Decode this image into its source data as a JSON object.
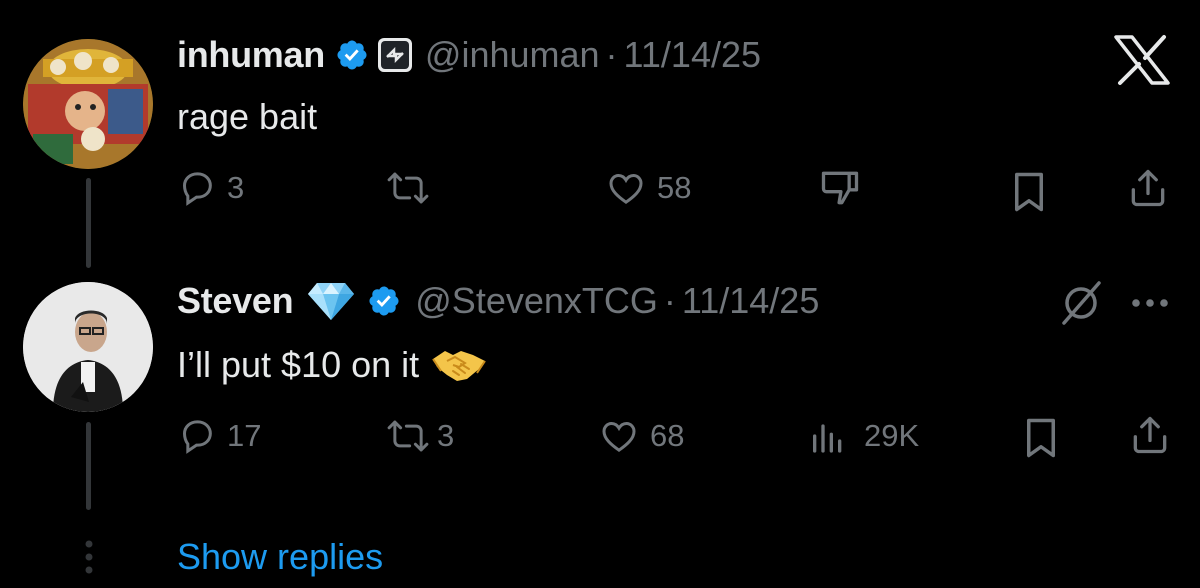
{
  "tweet1": {
    "display_name": "inhuman",
    "handle": "@inhuman",
    "separator": "·",
    "date": "11/14/25",
    "text": "rage bait",
    "actions": {
      "reply_count": "3",
      "like_count": "58"
    },
    "icons": [
      "reply-icon",
      "retweet-icon",
      "like-icon",
      "dislike-icon",
      "bookmark-icon",
      "share-icon",
      "x-logo-icon"
    ]
  },
  "tweet2": {
    "display_name": "Steven",
    "handle": "@StevenxTCG",
    "separator": "·",
    "date": "11/14/25",
    "text": "I’ll put $10 on it",
    "actions": {
      "reply_count": "17",
      "retweet_count": "3",
      "like_count": "68",
      "view_count": "29K"
    },
    "icons": [
      "reply-icon",
      "retweet-icon",
      "like-icon",
      "views-icon",
      "bookmark-icon",
      "share-icon",
      "grok-icon",
      "more-icon"
    ]
  },
  "show_replies_label": "Show replies",
  "colors": {
    "background": "#000000",
    "text": "#e7e9ea",
    "muted": "#71767b",
    "link": "#1d9bf0",
    "verified": "#1d9bf0",
    "thread_line": "#333639"
  }
}
